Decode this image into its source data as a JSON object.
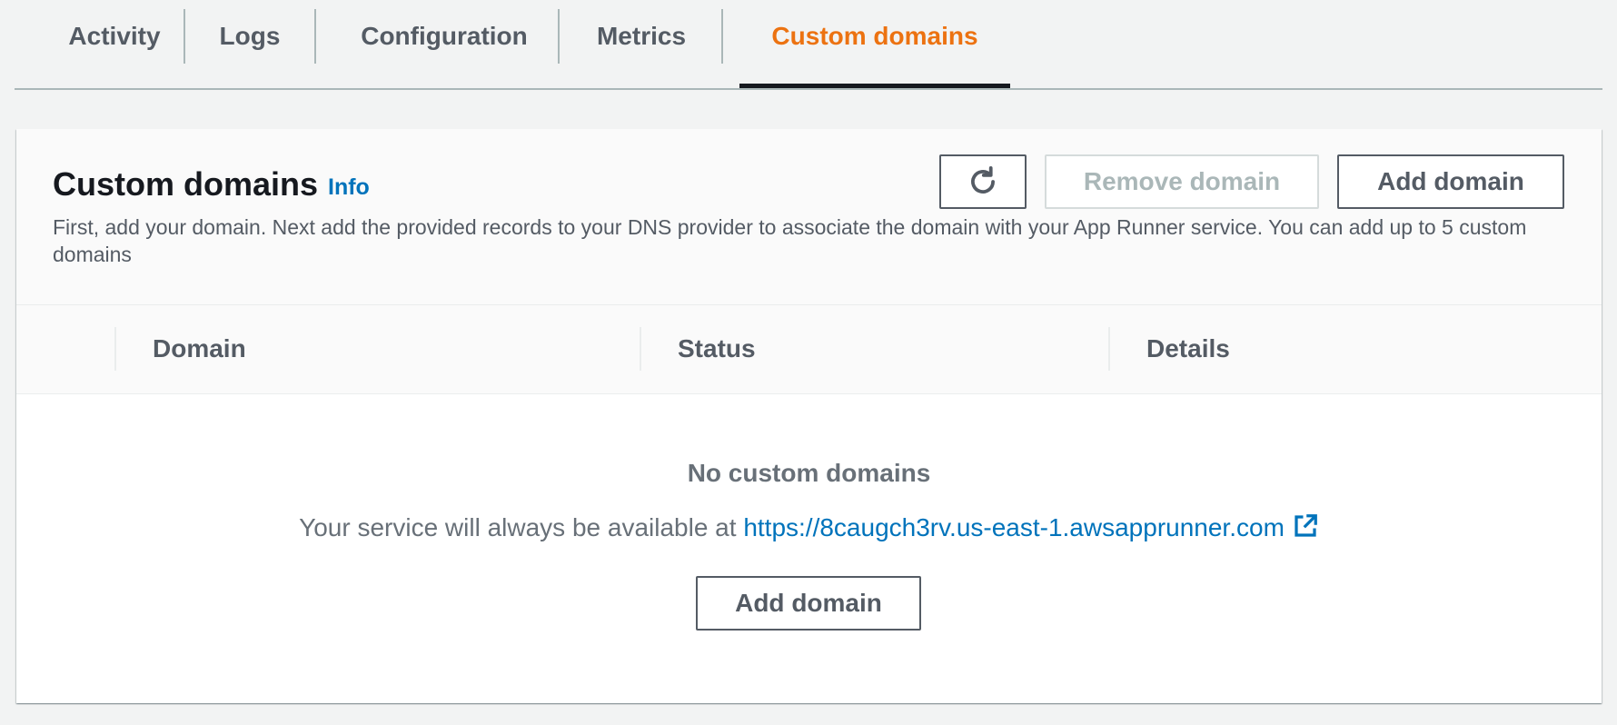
{
  "tabs": [
    {
      "label": "Activity",
      "active": false
    },
    {
      "label": "Logs",
      "active": false
    },
    {
      "label": "Configuration",
      "active": false
    },
    {
      "label": "Metrics",
      "active": false
    },
    {
      "label": "Custom domains",
      "active": true
    }
  ],
  "panel": {
    "title": "Custom domains",
    "info_label": "Info",
    "description": "First, add your domain. Next add the provided records to your DNS provider to associate the domain with your App Runner service. You can add up to 5 custom domains",
    "refresh_icon": "refresh-icon",
    "remove_domain_label": "Remove domain",
    "add_domain_label": "Add domain"
  },
  "table": {
    "columns": [
      "Domain",
      "Status",
      "Details"
    ]
  },
  "empty_state": {
    "title": "No custom domains",
    "text_prefix": "Your service will always be available at",
    "service_url": "https://8caugch3rv.us-east-1.awsapprunner.com",
    "external_icon": "external-link-icon",
    "add_domain_label": "Add domain"
  },
  "colors": {
    "accent": "#ec7211",
    "link": "#0073bb",
    "text_secondary": "#545b64",
    "disabled": "#aab7b8"
  }
}
